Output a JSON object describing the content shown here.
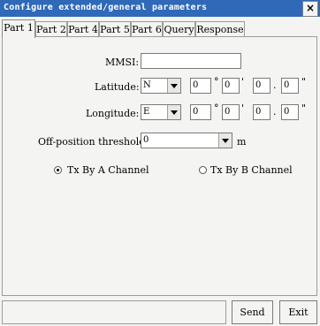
{
  "window": {
    "title": "Configure extended/general parameters",
    "close_label": "×"
  },
  "tabs": [
    {
      "label": "Part 1",
      "active": true
    },
    {
      "label": "Part 2",
      "active": false
    },
    {
      "label": "Part 4",
      "active": false
    },
    {
      "label": "Part 5",
      "active": false
    },
    {
      "label": "Part 6",
      "active": false
    },
    {
      "label": "Query",
      "active": false
    },
    {
      "label": "Response",
      "active": false
    }
  ],
  "form": {
    "mmsi_label": "MMSI:",
    "mmsi_value": "",
    "latitude_label": "Latitude:",
    "latitude_dir": "N",
    "latitude_deg": "0",
    "latitude_min": "0",
    "latitude_min_int": "0",
    "latitude_min_frac": "0",
    "longitude_label": "Longitude:",
    "longitude_dir": "E",
    "longitude_deg": "0",
    "longitude_min": "0",
    "longitude_min_int": "0",
    "longitude_min_frac": "0",
    "degree_symbol": "°",
    "minute_symbol": "'",
    "second_symbol": "\"",
    "dot_symbol": ".",
    "offpos_label": "Off-position threshold:",
    "offpos_value": "0",
    "offpos_unit": "m",
    "radio_a_label": "Tx By A Channel",
    "radio_b_label": "Tx By B Channel",
    "radio_a_selected": true
  },
  "footer": {
    "status_text": "",
    "send_label": "Send",
    "exit_label": "Exit"
  }
}
